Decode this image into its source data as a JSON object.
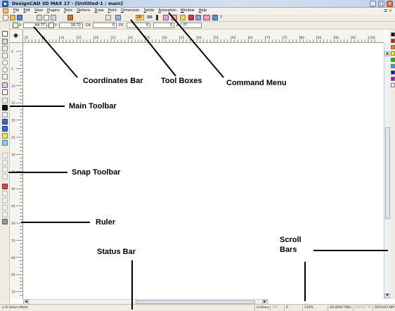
{
  "window": {
    "title": "DesignCAD 3D MAX 17 - [Untitled-1 : main]",
    "minimize": "_",
    "maximize": "□",
    "close": "✕"
  },
  "menu": {
    "items": [
      "File",
      "Edit",
      "View",
      "Plugins",
      "Tools",
      "Options",
      "Draw",
      "Point",
      "Dimension",
      "Solids",
      "Animation",
      "Window",
      "Help"
    ],
    "right_controls": "- ⧉ ✕"
  },
  "command_toolbar": {
    "mode_2d": "2D",
    "mode_3d": "3D",
    "help": "?"
  },
  "coordinates": {
    "x_label": "X",
    "x_value": "44.77",
    "y_label": "Y",
    "y_value": "16.72",
    "dx_label": "DX",
    "dx_value": "0",
    "dy_label": "DY",
    "dy_value": "0",
    "d_value": "0",
    "a_label": "A",
    "a_value": "0°"
  },
  "ruler": {
    "h_ticks": [
      "0",
      "5",
      "10",
      "15",
      "20",
      "25",
      "30",
      "35",
      "40",
      "45",
      "50",
      "55",
      "60",
      "65",
      "70",
      "75",
      "80",
      "85",
      "90",
      "95",
      "100"
    ],
    "v_ticks": [
      "0",
      "5",
      "10",
      "15",
      "20",
      "25",
      "30",
      "35",
      "40",
      "45",
      "50",
      "55",
      "60",
      "65",
      "70"
    ]
  },
  "palette": {
    "colors": [
      "#000000",
      "#ff0000",
      "#ff8000",
      "#ffff00",
      "#00c000",
      "#00c0c0",
      "#0000ff",
      "#c000c0",
      "#ffffff"
    ]
  },
  "status": {
    "mode": "2-D Select Mode",
    "units": "Unitless",
    "ortho": "ORT",
    "value": "0",
    "zoom": "139%",
    "drafting": "2D DRAFTING",
    "preset": "PRESET PT",
    "default": "DEFAULT WP"
  },
  "annotations": {
    "coordinates_bar": "Coordinates Bar",
    "tool_boxes": "Tool Boxes",
    "command_menu": "Command Menu",
    "main_toolbar": "Main Toolbar",
    "snap_toolbar": "Snap Toolbar",
    "ruler": "Ruler",
    "status_bar": "Status Bar",
    "scroll_bars_1": "Scroll",
    "scroll_bars_2": "Bars"
  }
}
